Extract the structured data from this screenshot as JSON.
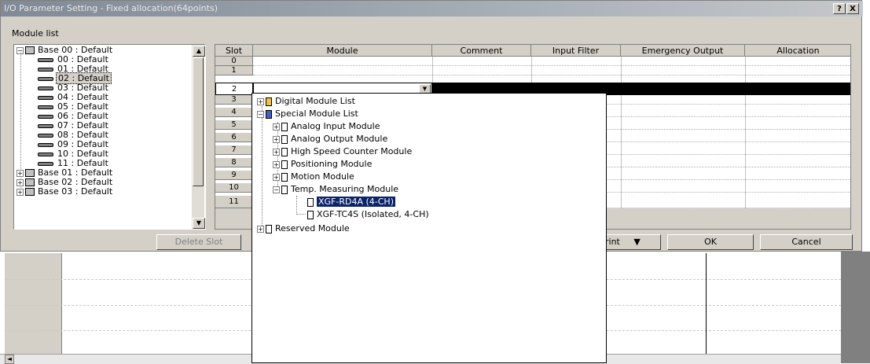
{
  "window": {
    "title": "I/O Parameter Setting - Fixed allocation(64points)",
    "help_label": "?",
    "close_label": "X"
  },
  "module_list_label": "Module list",
  "tree": {
    "base00": "Base 00 : Default",
    "slots": [
      "00 : Default",
      "01 : Default",
      "02 : Default",
      "03 : Default",
      "04 : Default",
      "05 : Default",
      "06 : Default",
      "07 : Default",
      "08 : Default",
      "09 : Default",
      "10 : Default",
      "11 : Default"
    ],
    "selected_slot": "02 : Default",
    "bases": [
      "Base 01 : Default",
      "Base 02 : Default",
      "Base 03 : Default"
    ]
  },
  "grid": {
    "columns": [
      "Slot",
      "Module",
      "Comment",
      "Input Filter",
      "Emergency Output",
      "Allocation"
    ],
    "slots": [
      "0",
      "1",
      "2",
      "3",
      "4",
      "5",
      "6",
      "7",
      "8",
      "9",
      "10",
      "11"
    ],
    "selected_slot": "2"
  },
  "buttons": {
    "delete_slot": "Delete Slot",
    "print": "rint",
    "print_arrow": "▼",
    "ok": "OK",
    "cancel": "Cancel"
  },
  "module_dropdown": {
    "digital": "Digital Module List",
    "special": "Special Module List",
    "analog_input": "Analog Input Module",
    "analog_output": "Analog Output Module",
    "high_speed_counter": "High Speed Counter Module",
    "positioning": "Positioning Module",
    "motion": "Motion Module",
    "temp_measuring": "Temp. Measuring Module",
    "rd4a": "XGF-RD4A (4-CH)",
    "tc4s": "XGF-TC4S (Isolated, 4-CH)",
    "reserved": "Reserved Module"
  },
  "colors": {
    "selection": "#0a246a",
    "dialog_bg": "#d4d0c8",
    "selected_row": "#000000"
  }
}
